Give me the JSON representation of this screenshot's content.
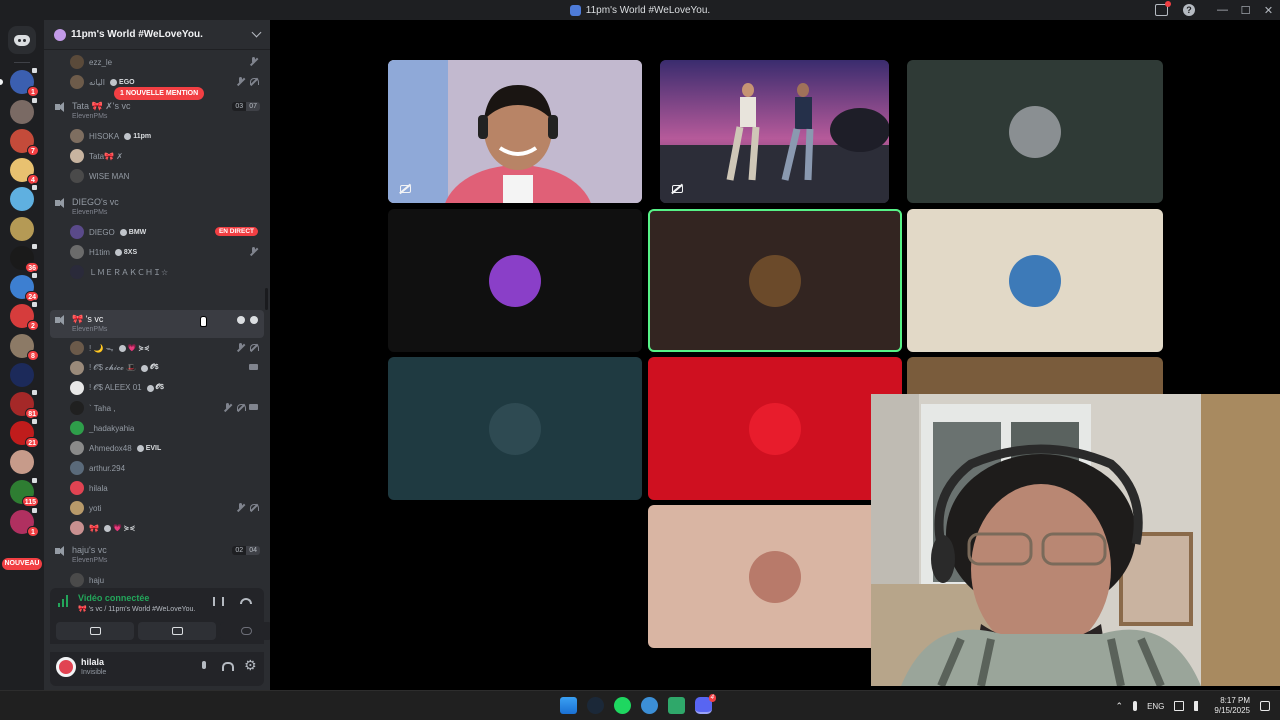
{
  "window": {
    "title": "11pm's World #WeLoveYou.",
    "controls": [
      "—",
      "☐",
      "✕"
    ]
  },
  "rail": {
    "servers": [
      {
        "color": "#3b5fb0",
        "badge": "1",
        "voice": true
      },
      {
        "color": "#7a6a64",
        "badge": "",
        "voice": true
      },
      {
        "color": "#c44b3a",
        "badge": "7",
        "voice": false
      },
      {
        "color": "#e8c170",
        "badge": "4",
        "voice": false
      },
      {
        "color": "#5fb0e0",
        "badge": "",
        "voice": true
      },
      {
        "color": "#b59a55",
        "badge": "",
        "voice": false
      },
      {
        "color": "#1a1a1a",
        "badge": "36",
        "voice": true
      },
      {
        "color": "#3d7fd1",
        "badge": "24",
        "voice": true
      },
      {
        "color": "#d63c3c",
        "badge": "2",
        "voice": true
      },
      {
        "color": "#8c7a66",
        "badge": "8",
        "voice": false
      },
      {
        "color": "#1c2a5a",
        "badge": "",
        "voice": false
      },
      {
        "color": "#a52828",
        "badge": "81",
        "voice": true
      },
      {
        "color": "#c01c1c",
        "badge": "21",
        "voice": true
      },
      {
        "color": "#c79b8a",
        "badge": "",
        "voice": false
      },
      {
        "color": "#2e7d32",
        "badge": "115",
        "voice": true
      },
      {
        "color": "#b03060",
        "badge": "1",
        "voice": true
      }
    ],
    "new_label": "NOUVEAU"
  },
  "guild": {
    "name": "11pm's World #WeLoveYou.",
    "mention_pill": "1 NOUVELLE MENTION"
  },
  "voice_channels": [
    {
      "name": "",
      "sub": "",
      "members": [
        {
          "name": "ezz_le",
          "tag": "",
          "color": "#5a4a3a",
          "icons": [
            "muted"
          ]
        },
        {
          "name": "اليانه",
          "tag": "EGO",
          "color": "#6d5b4a",
          "icons": [
            "muted",
            "deaf"
          ]
        }
      ]
    },
    {
      "name": "Tata 🎀 ✗'s vc",
      "sub": "ElevenPMs",
      "count_a": "03",
      "count_b": "07",
      "members": [
        {
          "name": "HISOKA",
          "tag": "11pm",
          "color": "#7e6e60",
          "icons": []
        },
        {
          "name": "Tata🎀 ✗",
          "tag": "",
          "color": "#c8b4a0",
          "icons": []
        },
        {
          "name": "WISE MAN",
          "tag": "",
          "color": "#4a4a4a",
          "icons": []
        }
      ]
    },
    {
      "name": "DIEGO's vc",
      "sub": "ElevenPMs",
      "members": [
        {
          "name": "DIEGO",
          "tag": "BMW",
          "color": "#5a4a8a",
          "icons": [],
          "live": "EN DIRECT"
        },
        {
          "name": "H1tim",
          "tag": "8XS",
          "color": "#6b6b6b",
          "icons": [
            "muted"
          ]
        },
        {
          "name": "ＬＭＥＲＡＫＣＨＩ☆",
          "tag": "",
          "color": "#2a2a3a",
          "icons": []
        }
      ]
    },
    {
      "name": "🎀 's vc",
      "sub": "ElevenPMs",
      "active": true,
      "members": [
        {
          "name": "! 🌙 ᯓ",
          "tag": "💗 ⋟⋞",
          "color": "#6b5a4a",
          "icons": [
            "muted",
            "deaf"
          ]
        },
        {
          "name": "! 𝓞$ 𝓬𝓱𝓲𝓬𝓸 🎩",
          "tag": "𝓞$",
          "color": "#9a8a7a",
          "icons": [
            "cam"
          ]
        },
        {
          "name": "! 𝓞$ ALEEX 01",
          "tag": "𝓞$",
          "color": "#e8e8e8",
          "icons": []
        },
        {
          "name": "` Taha ,",
          "tag": "",
          "color": "#202020",
          "icons": [
            "muted",
            "deaf",
            "cam"
          ]
        },
        {
          "name": "_hadakyahia",
          "tag": "",
          "color": "#2e9e4a",
          "icons": []
        },
        {
          "name": "Ahmedox48",
          "tag": "EVIL",
          "color": "#8a8a8a",
          "icons": []
        },
        {
          "name": "arthur.294",
          "tag": "",
          "color": "#5a6a7a",
          "icons": []
        },
        {
          "name": "hilala",
          "tag": "",
          "color": "#e14352",
          "icons": []
        },
        {
          "name": "yoti",
          "tag": "",
          "color": "#b89a6a",
          "icons": [
            "muted",
            "deaf"
          ]
        },
        {
          "name": "🎀",
          "tag": "💗 ⋟⋞",
          "color": "#c99090",
          "icons": []
        }
      ]
    },
    {
      "name": "haju's vc",
      "sub": "ElevenPMs",
      "count_a": "02",
      "count_b": "04",
      "members": [
        {
          "name": "haju",
          "tag": "",
          "color": "#4a4a4a",
          "icons": []
        }
      ]
    }
  ],
  "voice_status": {
    "status": "Vidéo connectée",
    "channel": "🎀 's vc / 11pm's World #WeLoveYou."
  },
  "user": {
    "name": "hilala",
    "status": "Invisible"
  },
  "tiles": [
    {
      "kind": "video",
      "scene": "person",
      "bg": "#b8a9c4"
    },
    {
      "kind": "video",
      "scene": "dance",
      "bg": "#3a2f5a"
    },
    {
      "kind": "avatar",
      "bg": "#2f3a36",
      "avatar_color": "#8a8f92"
    },
    {
      "kind": "avatar",
      "bg": "#101010",
      "avatar_color": "#8a3fc8"
    },
    {
      "kind": "avatar",
      "bg": "#332521",
      "avatar_color": "#6b4a2a",
      "speaking": true
    },
    {
      "kind": "avatar",
      "bg": "#e2d9c7",
      "avatar_color": "#3d7ab8"
    },
    {
      "kind": "avatar",
      "bg": "#1f3a41",
      "avatar_color": "#2e4a52"
    },
    {
      "kind": "avatar",
      "bg": "#cf1020",
      "avatar_color": "#e81c2c"
    },
    {
      "kind": "avatar",
      "bg": "#7a5c3c",
      "avatar_color": "#7a5c3c"
    },
    {
      "kind": "avatar",
      "bg": "#d9b5a3",
      "avatar_color": "#b87a6a"
    }
  ],
  "taskbar": {
    "lang": "ENG",
    "time": "8:17 PM",
    "date": "9/15/2025",
    "discord_badge": "4"
  },
  "icons": {
    "home": "discord-icon",
    "speaker": "speaker-icon",
    "settings": "gear-icon"
  }
}
